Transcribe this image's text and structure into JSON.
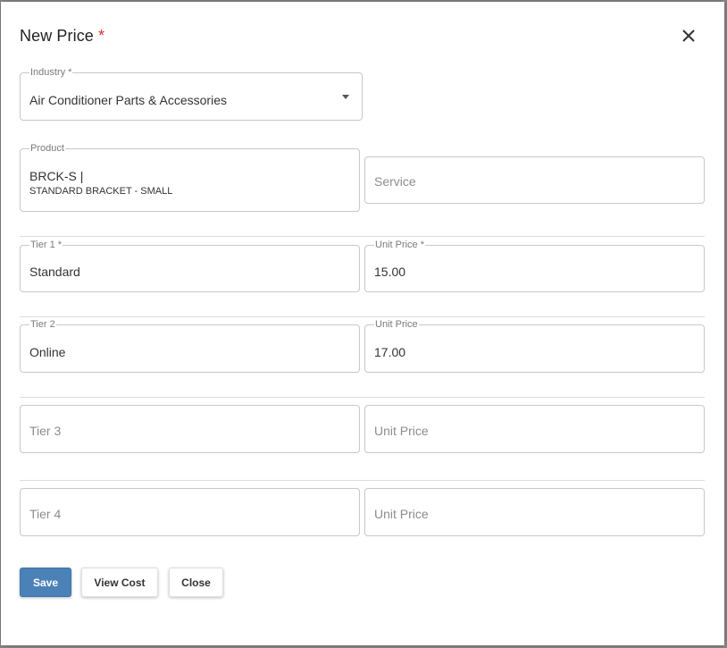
{
  "dialog": {
    "title": "New Price",
    "required_mark": "*"
  },
  "industry": {
    "label": "Industry *",
    "value": "Air Conditioner Parts & Accessories"
  },
  "product": {
    "label": "Product",
    "code": "BRCK-S |",
    "description": "STANDARD BRACKET - SMALL"
  },
  "service": {
    "placeholder": "Service"
  },
  "tiers": [
    {
      "tier_label": "Tier 1 *",
      "tier_value": "Standard",
      "price_label": "Unit Price *",
      "price_value": "15.00"
    },
    {
      "tier_label": "Tier 2",
      "tier_value": "Online",
      "price_label": "Unit Price",
      "price_value": "17.00"
    },
    {
      "tier_placeholder": "Tier 3",
      "price_placeholder": "Unit Price"
    },
    {
      "tier_placeholder": "Tier 4",
      "price_placeholder": "Unit Price"
    }
  ],
  "buttons": {
    "save": "Save",
    "view_cost": "View Cost",
    "close": "Close"
  },
  "colors": {
    "primary": "#4a82b8",
    "required": "#d93030"
  },
  "icons": {
    "close": "close-icon",
    "dropdown": "chevron-down-icon"
  }
}
